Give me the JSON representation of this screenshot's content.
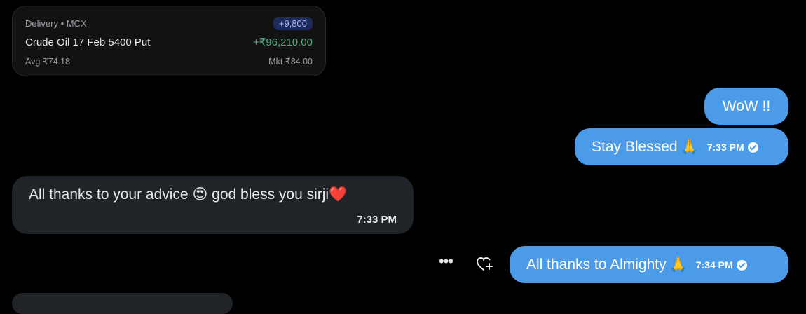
{
  "position_card": {
    "meta": "Delivery • MCX",
    "qty": "+9,800",
    "name": "Crude Oil 17 Feb 5400 Put",
    "pnl": "+₹96,210.00",
    "avg": "Avg ₹74.18",
    "mkt": "Mkt ₹84.00"
  },
  "messages": [
    {
      "id": "m1",
      "side": "outgoing",
      "text": "WoW !!"
    },
    {
      "id": "m2",
      "side": "outgoing",
      "text": "Stay Blessed",
      "emoji": "🙏",
      "time": "7:33 PM",
      "status": "sent"
    },
    {
      "id": "m3",
      "side": "incoming",
      "text": "All thanks to your advice 😍 god bless you sirji",
      "emoji": "❤️",
      "time": "7:33 PM"
    },
    {
      "id": "m4",
      "side": "outgoing",
      "text": "All thanks to Almighty",
      "emoji": "🙏",
      "time": "7:34 PM",
      "status": "sent"
    }
  ],
  "actions": {
    "more_icon": "more-dots-icon",
    "react_icon": "add-reaction-heart-icon"
  },
  "colors": {
    "background": "#000000",
    "outgoing_bubble": "#4c9be8",
    "incoming_bubble": "#202327",
    "pnl_positive": "#4caf7d",
    "qty_badge": "#1d2a5c"
  }
}
